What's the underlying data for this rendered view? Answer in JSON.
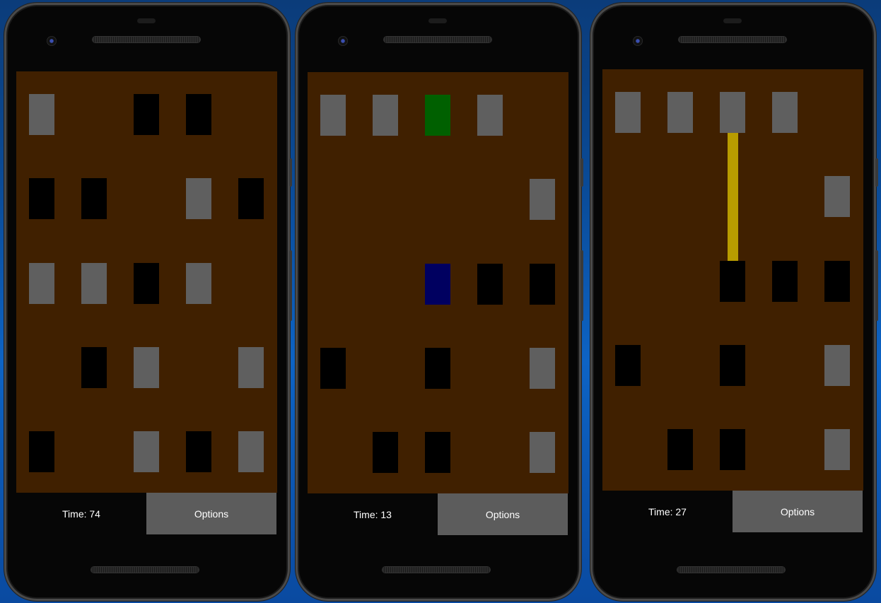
{
  "screens": [
    {
      "time_label": "Time: 74",
      "options_label": "Options",
      "tiles": [
        [
          "gray",
          "empty",
          "black",
          "black",
          "empty"
        ],
        [
          "black",
          "black",
          "empty",
          "gray",
          "black"
        ],
        [
          "gray",
          "gray",
          "black",
          "gray",
          "empty"
        ],
        [
          "empty",
          "black",
          "gray",
          "empty",
          "gray"
        ],
        [
          "black",
          "empty",
          "gray",
          "black",
          "gray"
        ]
      ]
    },
    {
      "time_label": "Time: 13",
      "options_label": "Options",
      "tiles": [
        [
          "gray",
          "gray",
          "green",
          "gray",
          "empty"
        ],
        [
          "empty",
          "empty",
          "empty",
          "empty",
          "gray"
        ],
        [
          "empty",
          "empty",
          "blue",
          "black",
          "black"
        ],
        [
          "black",
          "empty",
          "black",
          "empty",
          "gray"
        ],
        [
          "empty",
          "black",
          "black",
          "empty",
          "gray"
        ]
      ]
    },
    {
      "time_label": "Time: 27",
      "options_label": "Options",
      "tiles": [
        [
          "gray",
          "gray",
          "gray",
          "gray",
          "empty"
        ],
        [
          "empty",
          "empty",
          "empty",
          "empty",
          "gray"
        ],
        [
          "empty",
          "empty",
          "black",
          "black",
          "black"
        ],
        [
          "black",
          "empty",
          "black",
          "empty",
          "gray"
        ],
        [
          "empty",
          "black",
          "black",
          "empty",
          "gray"
        ]
      ],
      "highlight_path": {
        "column": 2,
        "from_row": 0,
        "to_row": 2,
        "color": "#b89c00"
      }
    }
  ],
  "colors": {
    "board": "#402000",
    "gray_tile": "#5f5f5f",
    "black_tile": "#000000",
    "green_tile": "#006000",
    "blue_tile": "#000060",
    "options_button": "#5c5c5c"
  }
}
